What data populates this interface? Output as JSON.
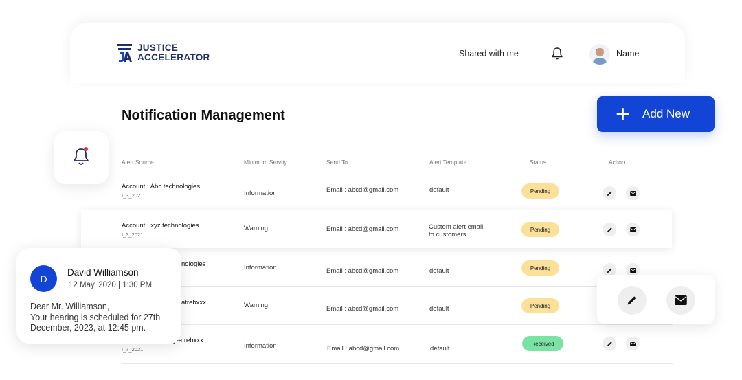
{
  "header": {
    "logo_line1": "JUSTICE",
    "logo_line2": "ACCELERATOR",
    "shared_label": "Shared with me",
    "user_name": "Name"
  },
  "page_title": "Notification Management",
  "add_new_label": "Add New",
  "table": {
    "columns": [
      "Alert Source",
      "Minimum Servity",
      "Send To",
      "Alert Template",
      "Status",
      "Action"
    ],
    "rows": [
      {
        "source": "Account : Abc technologies",
        "id": "I_3_2021",
        "severity": "Information",
        "send_to": "Email : abcd@gmail.com",
        "template": "default",
        "status": "Pending"
      },
      {
        "source": "Account : xyz technologies",
        "id": "I_3_2021",
        "severity": "Warning",
        "send_to": "Email : abcd@gmail.com",
        "template": "Custom alert email\nto customers",
        "status": "Pending"
      },
      {
        "source": "nologies",
        "id": "",
        "severity": "Information",
        "send_to": "Email : abcd@gmail.com",
        "template": "default",
        "status": "Pending"
      },
      {
        "source": "atrebxxx",
        "id": "",
        "severity": "Warning",
        "send_to": "Email : abcd@gmail.com",
        "template": "default",
        "status": "Pending"
      },
      {
        "source": "y-atrebxxx",
        "id": "I_7_2021",
        "severity": "Information",
        "send_to": "Email : abcd@gmail.com",
        "template": "default",
        "status": "Received"
      }
    ]
  },
  "message": {
    "avatar_initial": "D",
    "sender": "David Williamson",
    "date": "12 May, 2020 | 1:30 PM",
    "body": "Dear Mr. Williamson,\n Your hearing is scheduled for 27th December, 2023, at 12:45 pm."
  },
  "colors": {
    "primary": "#1244d6",
    "brand_dark": "#1f2f6b",
    "pending": "#fbe09a",
    "received": "#7ae3a4",
    "notification_dot": "#e53935"
  },
  "icons": {
    "bell": "bell-icon",
    "edit": "pencil-icon",
    "mail": "envelope-icon",
    "add": "plus-icon"
  }
}
